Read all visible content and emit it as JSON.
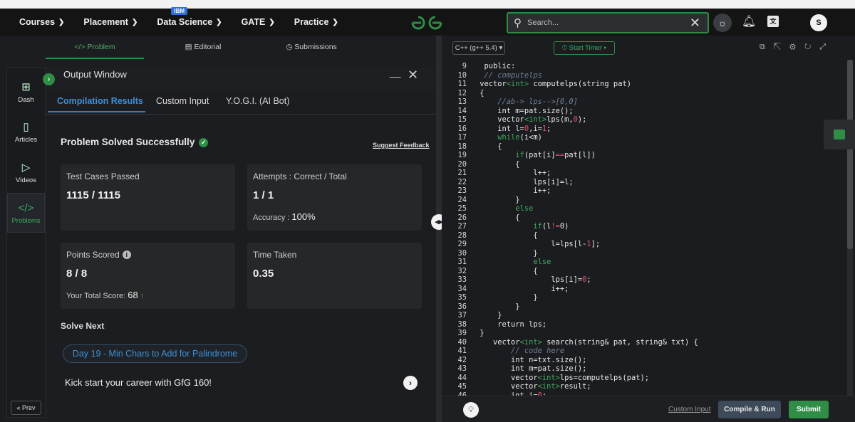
{
  "nav": {
    "items": [
      {
        "label": "Courses"
      },
      {
        "label": "Placement"
      },
      {
        "label": "Data Science",
        "badge": "IBM"
      },
      {
        "label": "GATE"
      },
      {
        "label": "Practice"
      }
    ],
    "search_placeholder": "Search...",
    "avatar_initial": "S"
  },
  "problem_tabs": [
    "Problem",
    "Editorial",
    "Submissions"
  ],
  "sidebar": {
    "items": [
      "Dash",
      "Articles",
      "Videos",
      "Problems"
    ],
    "prev_label": "Prev"
  },
  "output_window": {
    "title": "Output Window",
    "tabs": [
      "Compilation Results",
      "Custom Input",
      "Y.O.G.I. (AI Bot)"
    ],
    "status": "Problem Solved Successfully",
    "feedback_link": "Suggest Feedback",
    "cards": {
      "test_cases_label": "Test Cases Passed",
      "test_cases_value": "1115 / 1115",
      "attempts_label": "Attempts : Correct / Total",
      "attempts_value": "1 / 1",
      "accuracy_label": "Accuracy :",
      "accuracy_value": "100%",
      "points_label": "Points Scored",
      "points_value": "8 / 8",
      "total_score_label": "Your Total Score:",
      "total_score_value": "68",
      "time_label": "Time Taken",
      "time_value": "0.35"
    },
    "solve_next_label": "Solve Next",
    "solve_next_link": "Day 19 - Min Chars to Add for Palindrome",
    "career_text": "Kick start your career with GfG 160!"
  },
  "editor": {
    "language": "C++ (g++ 5.4)",
    "timer_label": "Start Timer",
    "lines": [
      {
        "n": "9",
        "text": "  public:"
      },
      {
        "n": "10",
        "text": "  // computelps"
      },
      {
        "n": "11",
        "text": " vector<int> computelps(string pat)"
      },
      {
        "n": "12",
        "text": " {"
      },
      {
        "n": "13",
        "text": "     //ab-> lps-->[0,0]"
      },
      {
        "n": "14",
        "text": "     int m=pat.size();"
      },
      {
        "n": "15",
        "text": "     vector<int>lps(m,0);"
      },
      {
        "n": "16",
        "text": "     int l=0,i=1;"
      },
      {
        "n": "17",
        "text": "     while(i<m)"
      },
      {
        "n": "18",
        "text": "     {"
      },
      {
        "n": "19",
        "text": "         if(pat[i]==pat[l])"
      },
      {
        "n": "20",
        "text": "         {"
      },
      {
        "n": "21",
        "text": "             l++;"
      },
      {
        "n": "22",
        "text": "             lps[i]=l;"
      },
      {
        "n": "23",
        "text": "             i++;"
      },
      {
        "n": "24",
        "text": "         }"
      },
      {
        "n": "25",
        "text": "         else"
      },
      {
        "n": "26",
        "text": "         {"
      },
      {
        "n": "27",
        "text": "             if(l!=0)"
      },
      {
        "n": "28",
        "text": "             {"
      },
      {
        "n": "29",
        "text": "                 l=lps[l-1];"
      },
      {
        "n": "30",
        "text": "             }"
      },
      {
        "n": "31",
        "text": "             else"
      },
      {
        "n": "32",
        "text": "             {"
      },
      {
        "n": "33",
        "text": "                 lps[i]=0;"
      },
      {
        "n": "34",
        "text": "                 i++;"
      },
      {
        "n": "35",
        "text": "             }"
      },
      {
        "n": "36",
        "text": "         }"
      },
      {
        "n": "37",
        "text": "     }"
      },
      {
        "n": "38",
        "text": "     return lps;"
      },
      {
        "n": "39",
        "text": " }"
      },
      {
        "n": "40",
        "text": "    vector<int> search(string& pat, string& txt) {"
      },
      {
        "n": "41",
        "text": "        // code here"
      },
      {
        "n": "42",
        "text": "        int n=txt.size();"
      },
      {
        "n": "43",
        "text": "        int m=pat.size();"
      },
      {
        "n": "44",
        "text": "        vector<int>lps=computelps(pat);"
      },
      {
        "n": "45",
        "text": "        vector<int>result;"
      },
      {
        "n": "46",
        "text": "        int i=0;"
      }
    ],
    "custom_input_label": "Custom Input",
    "compile_label": "Compile & Run",
    "submit_label": "Submit"
  }
}
